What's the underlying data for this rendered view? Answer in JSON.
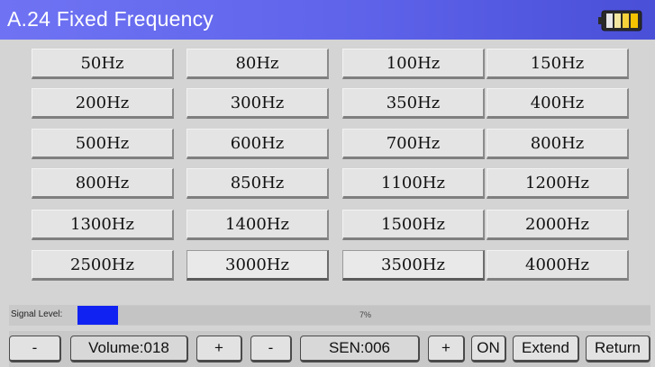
{
  "window": {
    "title": "A.24 Fixed Frequency",
    "battery_icon": "battery-icon"
  },
  "frequencies": [
    [
      "50Hz",
      "80Hz",
      "100Hz",
      "150Hz"
    ],
    [
      "200Hz",
      "300Hz",
      "350Hz",
      "400Hz"
    ],
    [
      "500Hz",
      "600Hz",
      "700Hz",
      "800Hz"
    ],
    [
      "800Hz",
      "850Hz",
      "1100Hz",
      "1200Hz"
    ],
    [
      "1300Hz",
      "1400Hz",
      "1500Hz",
      "2000Hz"
    ],
    [
      "2500Hz",
      "3000Hz",
      "3500Hz",
      "4000Hz"
    ]
  ],
  "signal": {
    "label": "Signal Level",
    "percent_text": "7%",
    "level": 0.07,
    "fill_color": "#1022f2"
  },
  "controls": {
    "volume_minus": "-",
    "volume_value": "Volume:018",
    "volume_plus": "+",
    "sen_minus": "-",
    "sen_value": "SEN:006",
    "sen_plus": "+",
    "on": "ON",
    "extend": "Extend",
    "return": "Return"
  },
  "colors": {
    "title_bar": "#5e63ea",
    "background": "#d4d4d4"
  }
}
